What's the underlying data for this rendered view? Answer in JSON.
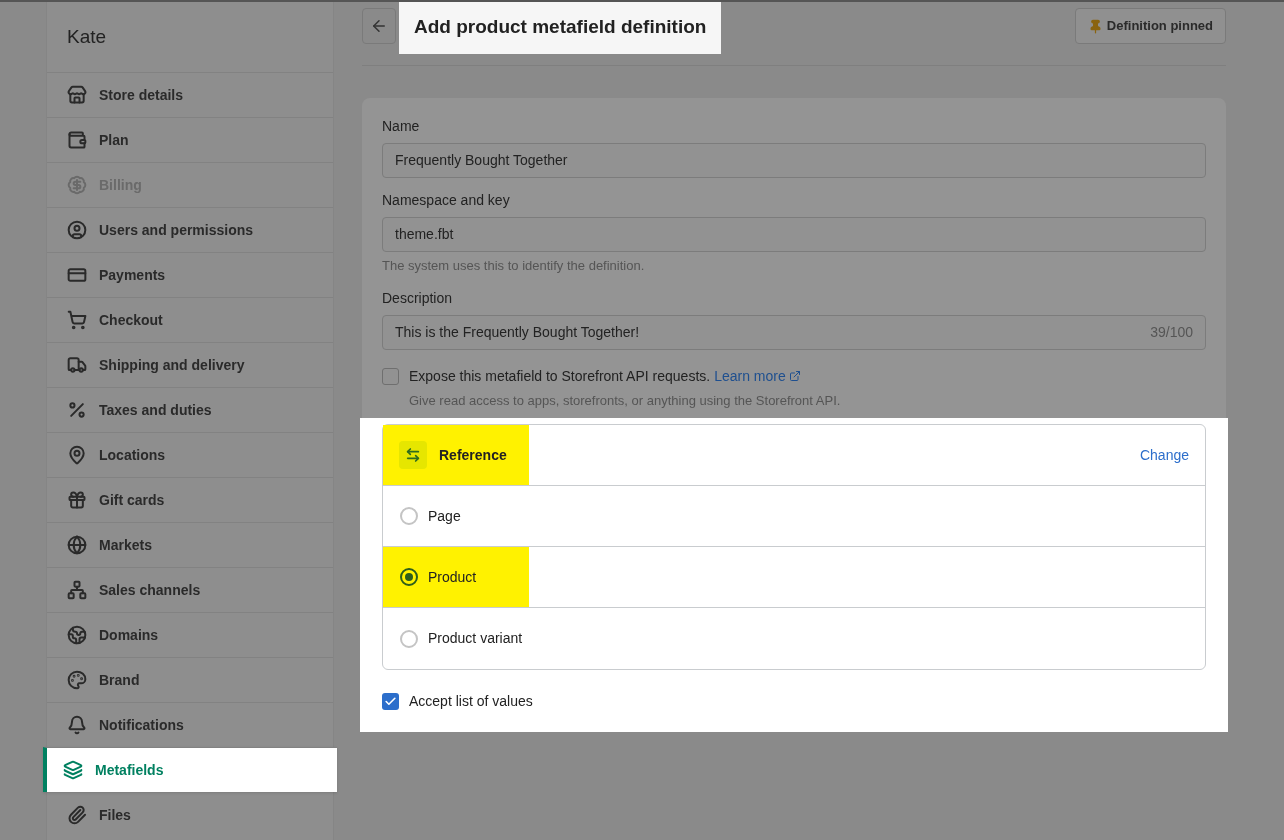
{
  "sidebar": {
    "title": "Kate",
    "items": [
      {
        "label": "Store details",
        "selected": false,
        "disabled": false
      },
      {
        "label": "Plan",
        "selected": false,
        "disabled": false
      },
      {
        "label": "Billing",
        "selected": false,
        "disabled": true
      },
      {
        "label": "Users and permissions",
        "selected": false,
        "disabled": false
      },
      {
        "label": "Payments",
        "selected": false,
        "disabled": false
      },
      {
        "label": "Checkout",
        "selected": false,
        "disabled": false
      },
      {
        "label": "Shipping and delivery",
        "selected": false,
        "disabled": false
      },
      {
        "label": "Taxes and duties",
        "selected": false,
        "disabled": false
      },
      {
        "label": "Locations",
        "selected": false,
        "disabled": false
      },
      {
        "label": "Gift cards",
        "selected": false,
        "disabled": false
      },
      {
        "label": "Markets",
        "selected": false,
        "disabled": false
      },
      {
        "label": "Sales channels",
        "selected": false,
        "disabled": false
      },
      {
        "label": "Domains",
        "selected": false,
        "disabled": false
      },
      {
        "label": "Brand",
        "selected": false,
        "disabled": false
      },
      {
        "label": "Notifications",
        "selected": false,
        "disabled": false
      },
      {
        "label": "Metafields",
        "selected": true,
        "disabled": false
      },
      {
        "label": "Files",
        "selected": false,
        "disabled": false
      }
    ]
  },
  "header": {
    "title": "Add product metafield definition",
    "pinned_button": "Definition pinned"
  },
  "form": {
    "fields": [
      {
        "label": "Name",
        "value": "Frequently Bought Together"
      },
      {
        "label": "Namespace and key",
        "value": "theme.fbt",
        "help": "The system uses this to identify the definition."
      },
      {
        "label": "Description",
        "value": "This is the Frequently Bought Together!",
        "counter": "39/100"
      }
    ],
    "expose": {
      "label": "Expose this metafield to Storefront API requests.",
      "link": "Learn more",
      "help": "Give read access to apps, storefronts, or anything using the Storefront API.",
      "checked": false
    }
  },
  "reference": {
    "type": "Reference",
    "highlighted": true,
    "change_link": "Change",
    "options": [
      {
        "label": "Page",
        "selected": false,
        "highlighted": false
      },
      {
        "label": "Product",
        "selected": true,
        "highlighted": true
      },
      {
        "label": "Product variant",
        "selected": false,
        "highlighted": false
      }
    ],
    "list_option": {
      "label": "Accept list of values",
      "checked": true
    }
  }
}
